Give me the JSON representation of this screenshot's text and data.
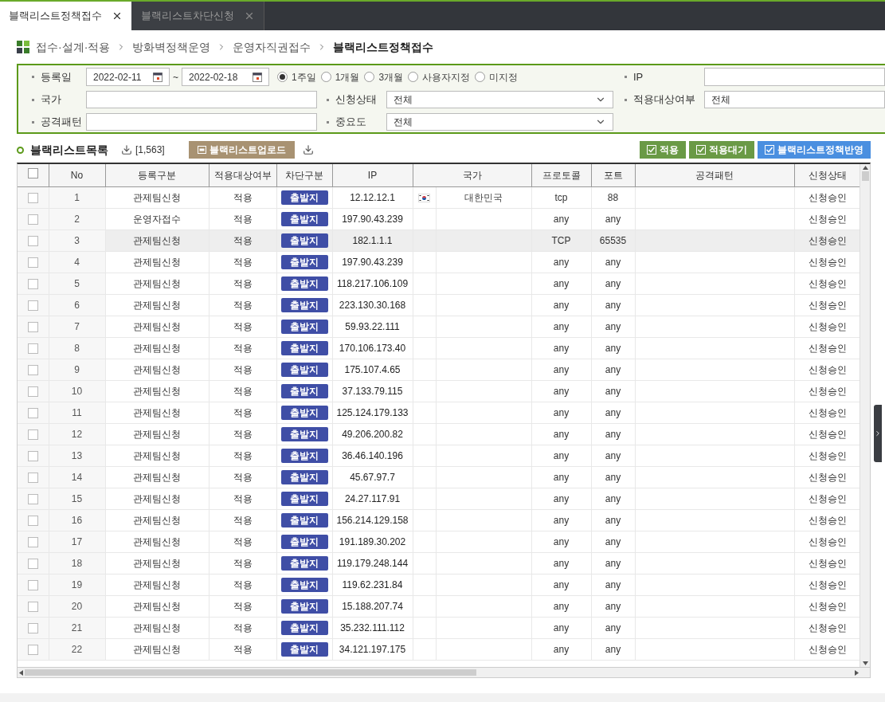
{
  "tabs": [
    {
      "label": "블랙리스트정책접수",
      "selected": true
    },
    {
      "label": "블랙리스트차단신청",
      "selected": false
    }
  ],
  "breadcrumb": [
    "접수·설계·적용",
    "방화벽정책운영",
    "운영자직권접수",
    "블랙리스트정책접수"
  ],
  "filters": {
    "date_label": "등록일",
    "date_from": "2022-02-11",
    "date_sep": "~",
    "date_to": "2022-02-18",
    "periods": [
      {
        "label": "1주일",
        "selected": true
      },
      {
        "label": "1개월",
        "selected": false
      },
      {
        "label": "3개월",
        "selected": false
      },
      {
        "label": "사용자지정",
        "selected": false
      },
      {
        "label": "미지정",
        "selected": false
      }
    ],
    "ip_label": "IP",
    "country_label": "국가",
    "status_label": "신청상태",
    "status_value": "전체",
    "apply_label": "적용대상여부",
    "apply_value": "전체",
    "pattern_label": "공격패턴",
    "importance_label": "중요도",
    "importance_value": "전체"
  },
  "list": {
    "title": "블랙리스트목록",
    "count": "[1,563]",
    "upload_button": "블랙리스트업로드",
    "actions": [
      {
        "label": "적용",
        "color": "#6a9a46"
      },
      {
        "label": "적용대기",
        "color": "#6a9a46"
      },
      {
        "label": "블랙리스트정책반영",
        "color": "#4a8fe0"
      }
    ]
  },
  "table": {
    "header_checked": false,
    "columns": [
      "No",
      "등록구분",
      "적용대상여부",
      "차단구분",
      "IP",
      "국가",
      "프로토콜",
      "포트",
      "공격패턴",
      "신청상태"
    ],
    "rows": [
      {
        "no": "1",
        "type": "관제팀신청",
        "apply": "적용",
        "block": "출발지",
        "ip": "12.12.12.1",
        "flag": true,
        "country": "대한민국",
        "protocol": "tcp",
        "port": "88",
        "status": "신청승인",
        "checked": false,
        "selected": false
      },
      {
        "no": "2",
        "type": "운영자접수",
        "apply": "적용",
        "block": "출발지",
        "ip": "197.90.43.239",
        "protocol": "any",
        "port": "any",
        "status": "신청승인",
        "checked": false,
        "selected": false
      },
      {
        "no": "3",
        "type": "관제팀신청",
        "apply": "적용",
        "block": "출발지",
        "ip": "182.1.1.1",
        "protocol": "TCP",
        "port": "65535",
        "status": "신청승인",
        "checked": false,
        "selected": true
      },
      {
        "no": "4",
        "type": "관제팀신청",
        "apply": "적용",
        "block": "출발지",
        "ip": "197.90.43.239",
        "protocol": "any",
        "port": "any",
        "status": "신청승인",
        "checked": false,
        "selected": false
      },
      {
        "no": "5",
        "type": "관제팀신청",
        "apply": "적용",
        "block": "출발지",
        "ip": "118.217.106.109",
        "protocol": "any",
        "port": "any",
        "status": "신청승인",
        "checked": false,
        "selected": false
      },
      {
        "no": "6",
        "type": "관제팀신청",
        "apply": "적용",
        "block": "출발지",
        "ip": "223.130.30.168",
        "protocol": "any",
        "port": "any",
        "status": "신청승인",
        "checked": false,
        "selected": false
      },
      {
        "no": "7",
        "type": "관제팀신청",
        "apply": "적용",
        "block": "출발지",
        "ip": "59.93.22.111",
        "protocol": "any",
        "port": "any",
        "status": "신청승인",
        "checked": false,
        "selected": false
      },
      {
        "no": "8",
        "type": "관제팀신청",
        "apply": "적용",
        "block": "출발지",
        "ip": "170.106.173.40",
        "protocol": "any",
        "port": "any",
        "status": "신청승인",
        "checked": false,
        "selected": false
      },
      {
        "no": "9",
        "type": "관제팀신청",
        "apply": "적용",
        "block": "출발지",
        "ip": "175.107.4.65",
        "protocol": "any",
        "port": "any",
        "status": "신청승인",
        "checked": false,
        "selected": false
      },
      {
        "no": "10",
        "type": "관제팀신청",
        "apply": "적용",
        "block": "출발지",
        "ip": "37.133.79.115",
        "protocol": "any",
        "port": "any",
        "status": "신청승인",
        "checked": false,
        "selected": false
      },
      {
        "no": "11",
        "type": "관제팀신청",
        "apply": "적용",
        "block": "출발지",
        "ip": "125.124.179.133",
        "protocol": "any",
        "port": "any",
        "status": "신청승인",
        "checked": false,
        "selected": false
      },
      {
        "no": "12",
        "type": "관제팀신청",
        "apply": "적용",
        "block": "출발지",
        "ip": "49.206.200.82",
        "protocol": "any",
        "port": "any",
        "status": "신청승인",
        "checked": false,
        "selected": false
      },
      {
        "no": "13",
        "type": "관제팀신청",
        "apply": "적용",
        "block": "출발지",
        "ip": "36.46.140.196",
        "protocol": "any",
        "port": "any",
        "status": "신청승인",
        "checked": false,
        "selected": false
      },
      {
        "no": "14",
        "type": "관제팀신청",
        "apply": "적용",
        "block": "출발지",
        "ip": "45.67.97.7",
        "protocol": "any",
        "port": "any",
        "status": "신청승인",
        "checked": false,
        "selected": false
      },
      {
        "no": "15",
        "type": "관제팀신청",
        "apply": "적용",
        "block": "출발지",
        "ip": "24.27.117.91",
        "protocol": "any",
        "port": "any",
        "status": "신청승인",
        "checked": false,
        "selected": false
      },
      {
        "no": "16",
        "type": "관제팀신청",
        "apply": "적용",
        "block": "출발지",
        "ip": "156.214.129.158",
        "protocol": "any",
        "port": "any",
        "status": "신청승인",
        "checked": false,
        "selected": false
      },
      {
        "no": "17",
        "type": "관제팀신청",
        "apply": "적용",
        "block": "출발지",
        "ip": "191.189.30.202",
        "protocol": "any",
        "port": "any",
        "status": "신청승인",
        "checked": false,
        "selected": false
      },
      {
        "no": "18",
        "type": "관제팀신청",
        "apply": "적용",
        "block": "출발지",
        "ip": "119.179.248.144",
        "protocol": "any",
        "port": "any",
        "status": "신청승인",
        "checked": false,
        "selected": false
      },
      {
        "no": "19",
        "type": "관제팀신청",
        "apply": "적용",
        "block": "출발지",
        "ip": "119.62.231.84",
        "protocol": "any",
        "port": "any",
        "status": "신청승인",
        "checked": false,
        "selected": false
      },
      {
        "no": "20",
        "type": "관제팀신청",
        "apply": "적용",
        "block": "출발지",
        "ip": "15.188.207.74",
        "protocol": "any",
        "port": "any",
        "status": "신청승인",
        "checked": false,
        "selected": false
      },
      {
        "no": "21",
        "type": "관제팀신청",
        "apply": "적용",
        "block": "출발지",
        "ip": "35.232.111.112",
        "protocol": "any",
        "port": "any",
        "status": "신청승인",
        "checked": false,
        "selected": false
      },
      {
        "no": "22",
        "type": "관제팀신청",
        "apply": "적용",
        "block": "출발지",
        "ip": "34.121.197.175",
        "protocol": "any",
        "port": "any",
        "status": "신청승인",
        "checked": false,
        "selected": false
      }
    ]
  }
}
